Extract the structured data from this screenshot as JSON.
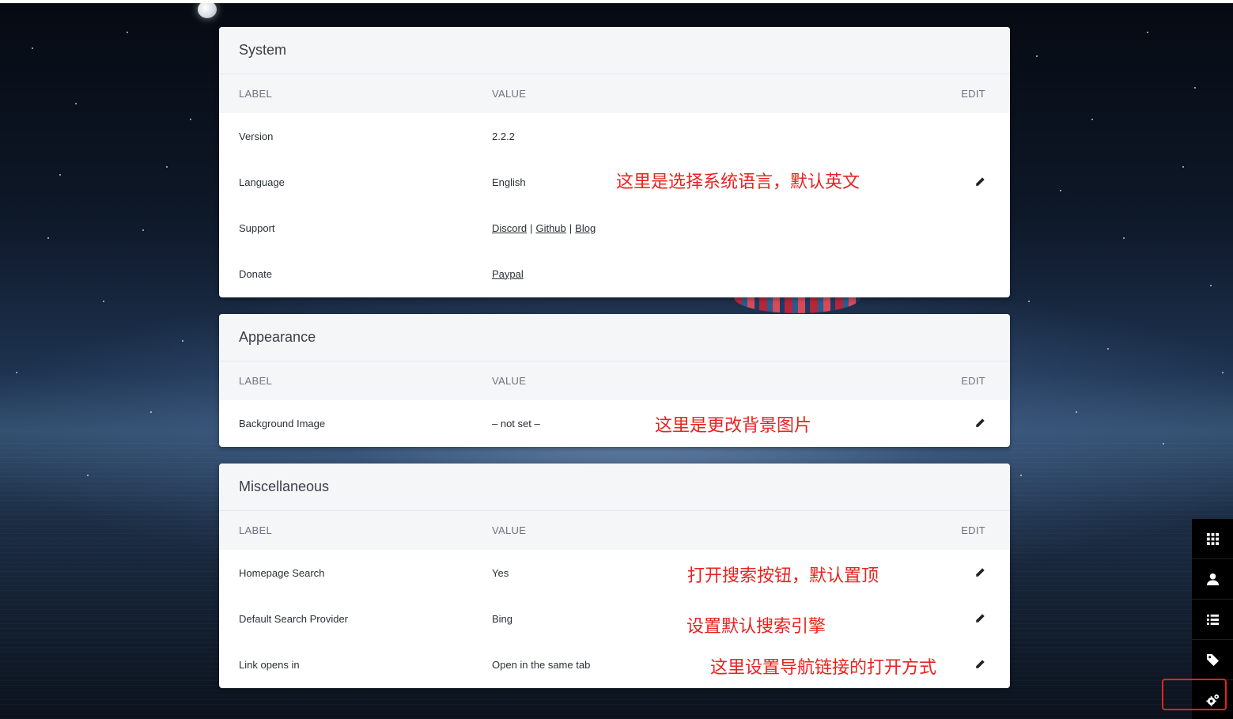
{
  "columns": {
    "label": "LABEL",
    "value": "VALUE",
    "edit": "EDIT"
  },
  "system": {
    "title": "System",
    "rows": {
      "version": {
        "label": "Version",
        "value": "2.2.2"
      },
      "language": {
        "label": "Language",
        "value": "English"
      },
      "support": {
        "label": "Support",
        "links": [
          "Discord",
          "Github",
          "Blog"
        ],
        "separator": "|"
      },
      "donate": {
        "label": "Donate",
        "link": "Paypal"
      }
    }
  },
  "appearance": {
    "title": "Appearance",
    "rows": {
      "background": {
        "label": "Background Image",
        "value": "– not set –"
      }
    }
  },
  "misc": {
    "title": "Miscellaneous",
    "rows": {
      "search": {
        "label": "Homepage Search",
        "value": "Yes"
      },
      "provider": {
        "label": "Default Search Provider",
        "value": "Bing"
      },
      "link_open": {
        "label": "Link opens in",
        "value": "Open in the same tab"
      }
    }
  },
  "annotations": {
    "language": "这里是选择系统语言，默认英文",
    "background": "这里是更改背景图片",
    "search": "打开搜索按钮，默认置顶",
    "provider": "设置默认搜索引擎",
    "link_open": "这里设置导航链接的打开方式"
  },
  "toolbar": {
    "icons": [
      "grid-icon",
      "user-icon",
      "list-icon",
      "tag-icon",
      "gears-icon"
    ],
    "highlight_color": "#e8231f"
  },
  "colors": {
    "annotation": "#e8231f",
    "card_header": "#f5f6f8",
    "toolbar": "#000000"
  }
}
